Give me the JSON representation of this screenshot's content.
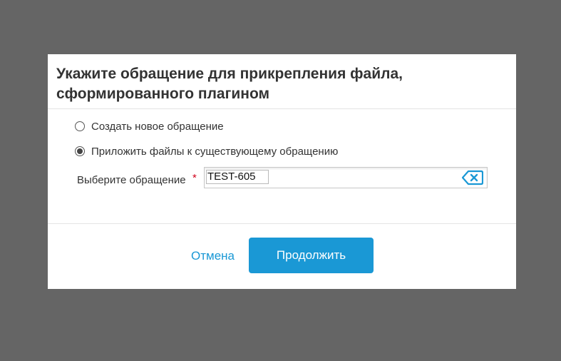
{
  "dialog": {
    "title": "Укажите обращение для прикрепления файла, сформированного плагином",
    "options": [
      {
        "label": "Создать новое обращение",
        "selected": false
      },
      {
        "label": "Приложить файлы к существующему обращению",
        "selected": true
      }
    ],
    "issue_field": {
      "label": "Выберите обращение",
      "required_mark": "*",
      "selected_value": "TEST-605",
      "clear_icon": "backspace-clear-icon"
    },
    "buttons": {
      "cancel_label": "Отмена",
      "continue_label": "Продолжить"
    }
  },
  "colors": {
    "overlay": "#656565",
    "accent": "#1a98d5",
    "required": "#d0021b"
  }
}
